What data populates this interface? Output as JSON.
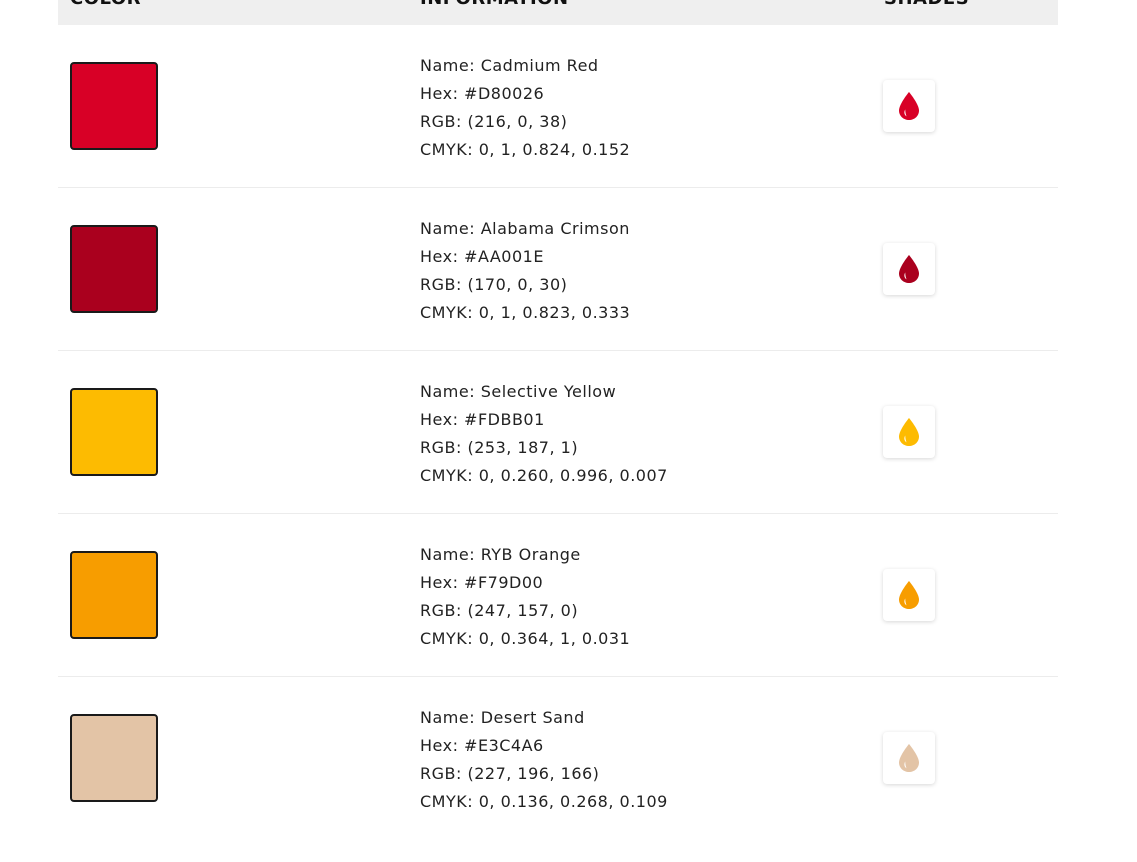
{
  "header": {
    "color_label": "COLOR",
    "info_label": "INFORMATION",
    "shades_label": "SHADES"
  },
  "prefixes": {
    "name": "Name: ",
    "hex": "Hex: ",
    "rgb": "RGB: ",
    "cmyk": "CMYK: "
  },
  "rows": [
    {
      "name": "Cadmium Red",
      "hex": "#D80026",
      "rgb": "(216, 0, 38)",
      "cmyk": "0, 1, 0.824, 0.152",
      "swatch_color": "#D80026",
      "icon": "drop-icon"
    },
    {
      "name": "Alabama Crimson",
      "hex": "#AA001E",
      "rgb": "(170, 0, 30)",
      "cmyk": "0, 1, 0.823, 0.333",
      "swatch_color": "#AA001E",
      "icon": "drop-icon"
    },
    {
      "name": "Selective Yellow",
      "hex": "#FDBB01",
      "rgb": "(253, 187, 1)",
      "cmyk": "0, 0.260, 0.996, 0.007",
      "swatch_color": "#FDBB01",
      "icon": "drop-icon"
    },
    {
      "name": "RYB Orange",
      "hex": "#F79D00",
      "rgb": "(247, 157, 0)",
      "cmyk": "0, 0.364, 1, 0.031",
      "swatch_color": "#F79D00",
      "icon": "drop-icon"
    },
    {
      "name": "Desert Sand",
      "hex": "#E3C4A6",
      "rgb": "(227, 196, 166)",
      "cmyk": "0, 0.136, 0.268, 0.109",
      "swatch_color": "#E3C4A6",
      "icon": "drop-icon"
    }
  ]
}
